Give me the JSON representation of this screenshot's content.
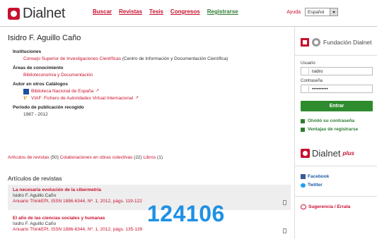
{
  "header": {
    "logo_text": "Dialnet",
    "nav": [
      "Buscar",
      "Revistas",
      "Tesis",
      "Congresos",
      "Registrarse"
    ],
    "help": "Ayuda",
    "language": "Español"
  },
  "author": {
    "name": "Isidro F. Aguillo Caño"
  },
  "institutions": {
    "title": "Instituciones",
    "link": "Consejo Superior de Investigaciones Científicas",
    "suffix": " (Centro de Información y Documentación Científica)"
  },
  "areas": {
    "title": "Áreas de conocimiento",
    "value": "Biblioteconomía y Documentación"
  },
  "catalogs": {
    "title": "Autor en otros Catálogos",
    "items": [
      "Biblioteca Nacional de España",
      "VIAF: Fichero de Autoridades Virtual Internacional"
    ]
  },
  "period": {
    "title": "Periodo de publicación recogido",
    "value": "1987 - 2012"
  },
  "counts": {
    "articles": "Artículos de revistas",
    "articles_n": " (50)",
    "collab": "Colaboraciones en obras colectivas",
    "collab_n": " (22)",
    "books": "Libros",
    "books_n": " (1)"
  },
  "articles_section": {
    "title": "Artículos de revistas",
    "items": [
      {
        "title": "La necesaria evolución de la cibermetría",
        "author": "Isidro F. Aguillo Caño",
        "source": "Anuario ThinkEPI, ISSN 1886-6344, Nº. 1, 2012, págs. 119-122"
      },
      {
        "title": "El año de las ciencias sociales y humanas",
        "author": "Isidro F. Aguillo Caño",
        "source": "Anuario ThinkEPI, ISSN 1886-6344, Nº. 1, 2012, págs. 135-139"
      }
    ]
  },
  "overlay_number": "124106",
  "sidebar": {
    "foundation": "Fundación Dialnet",
    "user_label": "Usuario",
    "user_value": "isidro",
    "pass_label": "Contraseña",
    "pass_value": "••••••••••",
    "login_button": "Entrar",
    "forgot": "Olvidó su contraseña",
    "advantages": "Ventajas de registrarse",
    "plus_text": "Dialnet",
    "plus_tag": "plus",
    "facebook": "Facebook",
    "twitter": "Twitter",
    "suggestion": "Sugerencia / Errata"
  },
  "colors": {
    "brand_red": "#c8102e",
    "green": "#2e7d32",
    "overlay_blue": "#1e90e6"
  }
}
